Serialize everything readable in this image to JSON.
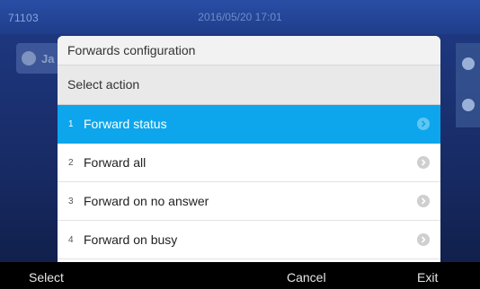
{
  "status_bar": {
    "extension": "71103",
    "datetime": "2016/05/20 17:01"
  },
  "background": {
    "line_label": "Ja"
  },
  "dialog": {
    "title": "Forwards configuration",
    "subtitle": "Select action",
    "items": [
      {
        "num": "1",
        "label": "Forward status",
        "selected": true
      },
      {
        "num": "2",
        "label": "Forward all",
        "selected": false
      },
      {
        "num": "3",
        "label": "Forward on no answer",
        "selected": false
      },
      {
        "num": "4",
        "label": "Forward on busy",
        "selected": false
      }
    ]
  },
  "softkeys": {
    "select": "Select",
    "cancel": "Cancel",
    "exit": "Exit"
  },
  "colors": {
    "selected_row": "#0da6ec",
    "softkey_bar": "#000000",
    "background": "#1f3a85"
  },
  "icons": {
    "line_icon": "phone-icon",
    "row_icon": "chevron-right-icon"
  }
}
